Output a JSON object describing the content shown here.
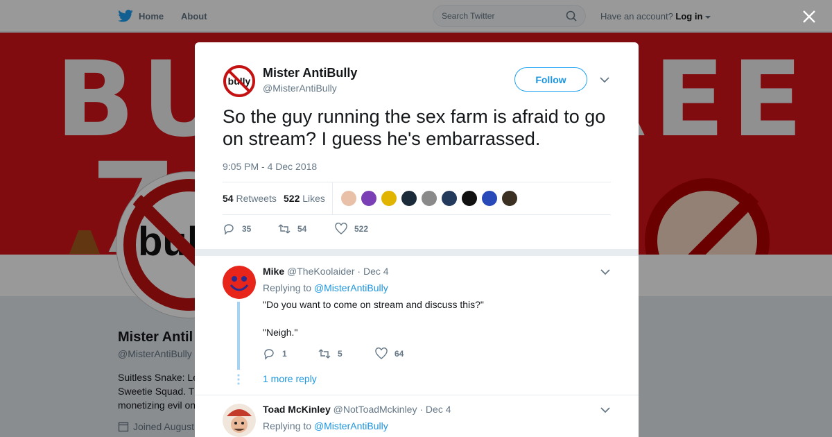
{
  "nav": {
    "home_label": "Home",
    "about_label": "About",
    "search_placeholder": "Search Twitter",
    "have_account_label": "Have an account?",
    "login_label": "Log in"
  },
  "profile": {
    "banner_text": "BULLY FREE",
    "banner_seven": "7",
    "avatar_word": "bul",
    "name": "Mister Antil",
    "handle": "@MisterAntiBully",
    "bio_lines": [
      "Suitless Snake: Le",
      "Sweetie Squad. T",
      "monetizing evil on"
    ],
    "joined": "Joined August"
  },
  "tweet": {
    "author_name": "Mister AntiBully",
    "author_handle": "@MisterAntiBully",
    "avatar_word": "bully",
    "follow_label": "Follow",
    "text": "So the guy running the sex farm is afraid to go on stream?  I guess he's embarrassed.",
    "timestamp": "9:05 PM - 4 Dec 2018",
    "retweets_count": "54",
    "retweets_label": "Retweets",
    "likes_count": "522",
    "likes_label": "Likes",
    "liker_colors": [
      "#e8c1a8",
      "#7b3fb5",
      "#e1b400",
      "#1c2b3a",
      "#8a8a8a",
      "#243a5c",
      "#111111",
      "#2849b8",
      "#3b3022"
    ],
    "reply_count": "35",
    "retweet_count": "54",
    "like_count": "522"
  },
  "replies": [
    {
      "name": "Mike",
      "handle": "@TheKoolaider",
      "date": "Dec 4",
      "replying_label": "Replying to",
      "replying_to": "@MisterAntiBully",
      "text_line1": "\"Do you want to come on stream and discuss this?\"",
      "text_line2": "\"Neigh.\"",
      "reply_count": "1",
      "retweet_count": "5",
      "like_count": "64",
      "more_replies": "1 more reply",
      "avatar_color": "#e8251a"
    },
    {
      "name": "Toad McKinley",
      "handle": "@NotToadMckinley",
      "date": "Dec 4",
      "replying_label": "Replying to",
      "replying_to": "@MisterAntiBully",
      "avatar_color": "#c23b2b"
    }
  ],
  "icons": {
    "logo": "twitter-bird-icon",
    "search": "search-icon",
    "close": "close-icon",
    "caret": "chevron-down-icon",
    "reply": "reply-icon",
    "retweet": "retweet-icon",
    "like": "heart-icon",
    "calendar": "calendar-icon"
  },
  "colors": {
    "twitter_blue": "#1da1f2",
    "link_blue": "#1b95e0",
    "banner_red": "#d6141b"
  }
}
